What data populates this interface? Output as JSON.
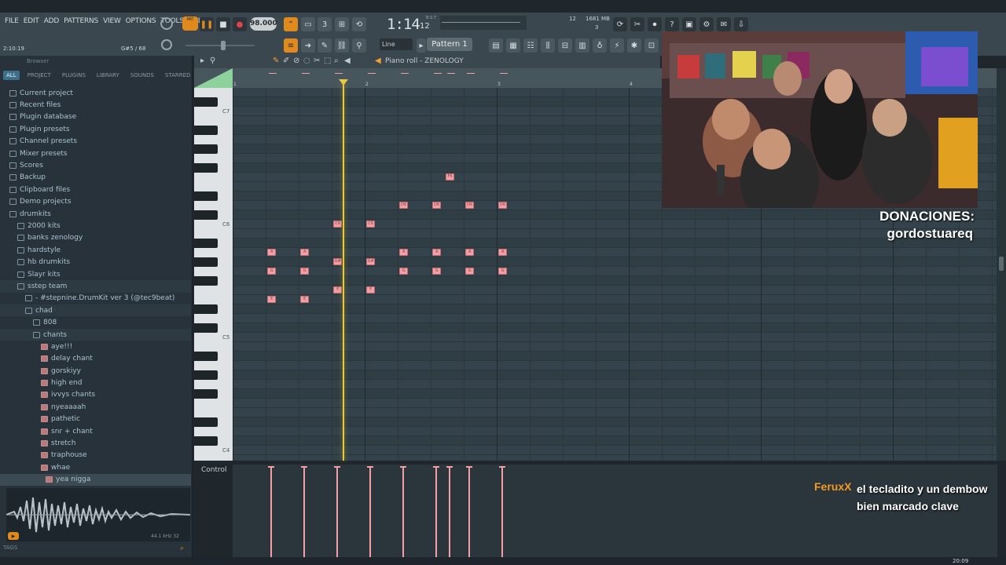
{
  "menu": [
    "FILE",
    "EDIT",
    "ADD",
    "PATTERNS",
    "VIEW",
    "OPTIONS",
    "TOOLS",
    "HELP"
  ],
  "transport": {
    "mode_label": "PAT",
    "bpm": "98.000",
    "time": "1:14",
    "time_sub": "12",
    "time_unit": "B:S:T",
    "cpu": "12",
    "memory": "1681 MB",
    "memory_sub": "3"
  },
  "hint": {
    "time": "2:10:19",
    "note": "G#5 / 68"
  },
  "snap": "Line",
  "pattern": "Pattern 1",
  "browser": {
    "title": "Browser",
    "tabs": [
      "ALL",
      "PROJECT",
      "PLUGINS",
      "LIBRARY",
      "SOUNDS",
      "STARRED"
    ],
    "items": [
      {
        "label": "Current project",
        "indent": 0,
        "kind": "folder"
      },
      {
        "label": "Recent files",
        "indent": 0,
        "kind": "folder"
      },
      {
        "label": "Plugin database",
        "indent": 0,
        "kind": "folder"
      },
      {
        "label": "Plugin presets",
        "indent": 0,
        "kind": "folder"
      },
      {
        "label": "Channel presets",
        "indent": 0,
        "kind": "folder"
      },
      {
        "label": "Mixer presets",
        "indent": 0,
        "kind": "folder"
      },
      {
        "label": "Scores",
        "indent": 0,
        "kind": "folder"
      },
      {
        "label": "Backup",
        "indent": 0,
        "kind": "folder"
      },
      {
        "label": "Clipboard files",
        "indent": 0,
        "kind": "folder"
      },
      {
        "label": "Demo projects",
        "indent": 0,
        "kind": "folder"
      },
      {
        "label": "drumkits",
        "indent": 0,
        "kind": "folder"
      },
      {
        "label": "2000 kits",
        "indent": 1,
        "kind": "folder"
      },
      {
        "label": "banks zenology",
        "indent": 1,
        "kind": "folder"
      },
      {
        "label": "hardstyle",
        "indent": 1,
        "kind": "folder"
      },
      {
        "label": "hb drumkits",
        "indent": 1,
        "kind": "folder"
      },
      {
        "label": "Slayr kits",
        "indent": 1,
        "kind": "folder"
      },
      {
        "label": "sstep team",
        "indent": 1,
        "kind": "folder"
      },
      {
        "label": "- #stepnine.DrumKit ver 3 (@tec9beat)",
        "indent": 2,
        "kind": "folder"
      },
      {
        "label": "chad",
        "indent": 2,
        "kind": "folder"
      },
      {
        "label": "808",
        "indent": 3,
        "kind": "folder"
      },
      {
        "label": "chants",
        "indent": 3,
        "kind": "folder"
      },
      {
        "label": "aye!!!",
        "indent": 4,
        "kind": "file"
      },
      {
        "label": "delay chant",
        "indent": 4,
        "kind": "file"
      },
      {
        "label": "gorskiyy",
        "indent": 4,
        "kind": "file"
      },
      {
        "label": "high end",
        "indent": 4,
        "kind": "file"
      },
      {
        "label": "ivvys chants",
        "indent": 4,
        "kind": "file"
      },
      {
        "label": "nyeaaaah",
        "indent": 4,
        "kind": "file"
      },
      {
        "label": "pathetic",
        "indent": 4,
        "kind": "file"
      },
      {
        "label": "snr + chant",
        "indent": 4,
        "kind": "file"
      },
      {
        "label": "stretch",
        "indent": 4,
        "kind": "file"
      },
      {
        "label": "traphouse",
        "indent": 4,
        "kind": "file"
      },
      {
        "label": "whae",
        "indent": 4,
        "kind": "file"
      },
      {
        "label": "yea nigga",
        "indent": 5,
        "kind": "file"
      }
    ],
    "wave_info": "44.1 kHz 32",
    "tags_label": "TAGS"
  },
  "piano_roll": {
    "title": "Piano roll - ZENOLOGY",
    "bars": [
      "1",
      "2",
      "3",
      "4"
    ],
    "octaves": [
      "C7",
      "C6",
      "C5",
      "C4"
    ],
    "control_label": "Control",
    "notes": [
      {
        "bar": 1.15,
        "pitch": "A5",
        "label": "A"
      },
      {
        "bar": 1.4,
        "pitch": "A5",
        "label": "A"
      },
      {
        "bar": 1.15,
        "pitch": "G5",
        "label": "G"
      },
      {
        "bar": 1.4,
        "pitch": "G5",
        "label": "G"
      },
      {
        "bar": 1.15,
        "pitch": "E5",
        "label": "E"
      },
      {
        "bar": 1.4,
        "pitch": "E5",
        "label": "E"
      },
      {
        "bar": 1.65,
        "pitch": "C6",
        "label": "C6"
      },
      {
        "bar": 1.9,
        "pitch": "C6",
        "label": "C6"
      },
      {
        "bar": 1.65,
        "pitch": "G#5",
        "label": "G#"
      },
      {
        "bar": 1.9,
        "pitch": "G#5",
        "label": "G#"
      },
      {
        "bar": 1.65,
        "pitch": "F5",
        "label": "F"
      },
      {
        "bar": 1.9,
        "pitch": "F5",
        "label": "F"
      },
      {
        "bar": 2.15,
        "pitch": "D6",
        "label": "D6"
      },
      {
        "bar": 2.4,
        "pitch": "D6",
        "label": "D6"
      },
      {
        "bar": 2.65,
        "pitch": "D6",
        "label": "D6"
      },
      {
        "bar": 2.9,
        "pitch": "D6",
        "label": "D6"
      },
      {
        "bar": 2.5,
        "pitch": "F6",
        "label": "F6"
      },
      {
        "bar": 2.15,
        "pitch": "A5",
        "label": "A"
      },
      {
        "bar": 2.4,
        "pitch": "A5",
        "label": "A"
      },
      {
        "bar": 2.65,
        "pitch": "A5",
        "label": "A"
      },
      {
        "bar": 2.9,
        "pitch": "A5",
        "label": "A"
      },
      {
        "bar": 2.15,
        "pitch": "G5",
        "label": "G"
      },
      {
        "bar": 2.4,
        "pitch": "G5",
        "label": "G"
      },
      {
        "bar": 2.65,
        "pitch": "G5",
        "label": "G"
      },
      {
        "bar": 2.9,
        "pitch": "G5",
        "label": "G"
      }
    ]
  },
  "overlay": {
    "donations_title": "DONACIONES:",
    "donations_user": "gordostuareq",
    "chat_user": "FeruxX",
    "chat_message": "el tecladito y un dembow bien marcado clave"
  },
  "taskbar": {
    "clock": "20:09"
  },
  "colors": {
    "note": "#f1a1a6",
    "playhead": "#e7c93f",
    "accent": "#e08a1e",
    "chat_user": "#f29b1e"
  }
}
